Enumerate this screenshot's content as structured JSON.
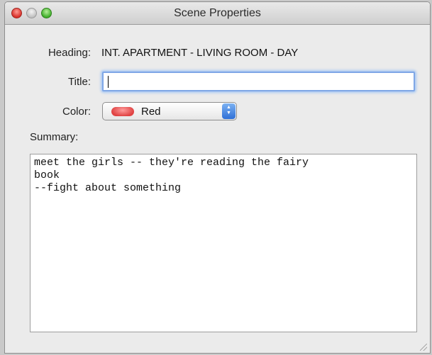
{
  "window": {
    "title": "Scene Properties"
  },
  "form": {
    "heading_label": "Heading:",
    "heading_value": "INT. APARTMENT - LIVING ROOM - DAY",
    "title_label": "Title:",
    "title_value": "",
    "color_label": "Color:",
    "color_selected": "Red",
    "color_swatch_hex": "#e04343",
    "summary_label": "Summary:",
    "summary_text": "meet the girls -- they're reading the fairy\nbook\n--fight about something"
  },
  "icons": {
    "close": "close-icon",
    "minimize": "minimize-icon",
    "zoom": "zoom-icon",
    "select_stepper": "chevron-up-down-icon",
    "resize": "resize-grip-icon"
  }
}
